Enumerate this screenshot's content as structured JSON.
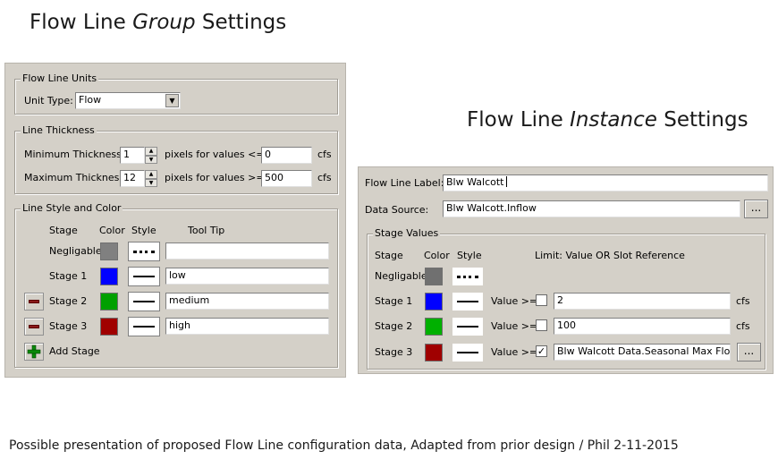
{
  "headings": {
    "group_pre": "Flow Line ",
    "group_em": "Group",
    "group_post": " Settings",
    "instance_pre": "Flow Line ",
    "instance_em": "Instance",
    "instance_post": " Settings"
  },
  "group_panel": {
    "units": {
      "legend": "Flow Line Units",
      "unit_type_label": "Unit Type:",
      "unit_type_value": "Flow"
    },
    "thickness": {
      "legend": "Line Thickness",
      "min_label": "Minimum Thickness:",
      "min_value": "1",
      "min_suffix": "pixels for values <=",
      "min_threshold": "0",
      "min_unit": "cfs",
      "max_label": "Maximum Thickness:",
      "max_value": "12",
      "max_suffix": "pixels for values >=",
      "max_threshold": "500",
      "max_unit": "cfs"
    },
    "style": {
      "legend": "Line Style and Color",
      "col_stage": "Stage",
      "col_color": "Color",
      "col_style": "Style",
      "col_tooltip": "Tool Tip",
      "rows": [
        {
          "stage": "Negligable",
          "color": "#808080",
          "line": "dotted",
          "tooltip": ""
        },
        {
          "stage": "Stage 1",
          "color": "#0000ff",
          "line": "solid",
          "tooltip": "low"
        },
        {
          "stage": "Stage 2",
          "color": "#00a000",
          "line": "solid",
          "tooltip": "medium"
        },
        {
          "stage": "Stage 3",
          "color": "#a00000",
          "line": "solid",
          "tooltip": "high"
        }
      ],
      "add_stage": "Add Stage"
    }
  },
  "instance_panel": {
    "label_label": "Flow Line Label:",
    "label_value": "Blw Walcott",
    "source_label": "Data Source:",
    "source_value": "Blw Walcott.Inflow",
    "browse": "...",
    "stage_values": {
      "legend": "Stage Values",
      "col_stage": "Stage",
      "col_color": "Color",
      "col_style": "Style",
      "col_limit": "Limit: Value OR Slot Reference",
      "value_prefix": "Value >=",
      "rows": [
        {
          "stage": "Negligable",
          "color": "#707070",
          "line": "dotted"
        },
        {
          "stage": "Stage 1",
          "color": "#0000ff",
          "line": "solid",
          "checked": false,
          "value": "2",
          "unit": "cfs"
        },
        {
          "stage": "Stage 2",
          "color": "#00b000",
          "line": "solid",
          "checked": false,
          "value": "100",
          "unit": "cfs"
        },
        {
          "stage": "Stage 3",
          "color": "#a00000",
          "line": "solid",
          "checked": true,
          "value": "Blw Walcott Data.Seasonal Max Flow",
          "browse": "..."
        }
      ]
    }
  },
  "footer": "Possible presentation of proposed Flow Line configuration data, Adapted from prior design / Phil 2-11-2015"
}
